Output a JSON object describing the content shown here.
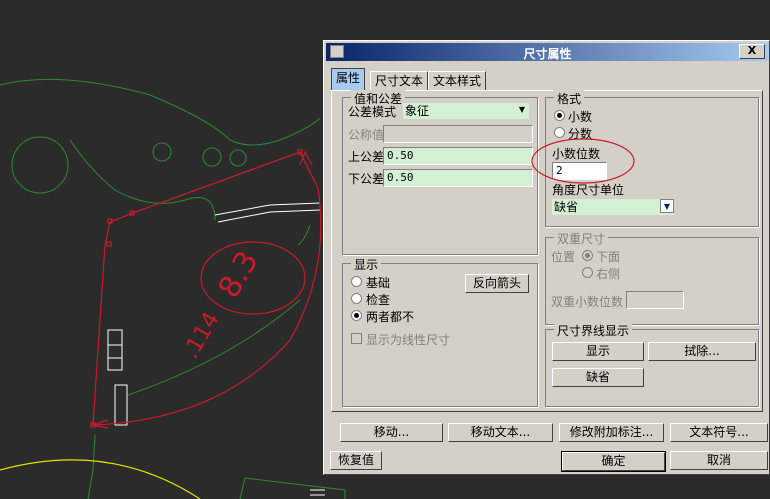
{
  "drawing": {
    "dimension_value": "8.3",
    "dimension_value_ocr": "83"
  },
  "dialog": {
    "title": "尺寸属性",
    "close_label": "X",
    "tabs": [
      {
        "label": "属性",
        "active": true
      },
      {
        "label": "尺寸文本",
        "active": false
      },
      {
        "label": "文本样式",
        "active": false
      }
    ],
    "tolerance": {
      "title": "值和公差",
      "mode_label": "公差模式",
      "mode_value": "象征",
      "nominal_label": "公称值",
      "nominal_value": "",
      "upper_label": "上公差",
      "upper_value": "0.50",
      "lower_label": "下公差",
      "lower_value": "0.50"
    },
    "format": {
      "title": "格式",
      "decimal_label": "小数",
      "fraction_label": "分数",
      "decimal_places_label": "小数位数",
      "decimal_places_value": "2",
      "angle_unit_label": "角度尺寸单位",
      "angle_unit_value": "缺省"
    },
    "display": {
      "title": "显示",
      "basic_label": "基础",
      "inspection_label": "检查",
      "neither_label": "两者都不",
      "flip_arrows_label": "反向箭头",
      "linear_label": "显示为线性尺寸"
    },
    "dual": {
      "title": "双重尺寸",
      "position_label": "位置",
      "below_label": "下面",
      "right_label": "右侧",
      "decimals_label": "双重小数位数",
      "decimals_value": ""
    },
    "witness": {
      "title": "尺寸界线显示",
      "show_label": "显示",
      "erase_label": "拭除...",
      "default_label": "缺省"
    },
    "action_buttons": {
      "move": "移动...",
      "move_text": "移动文本...",
      "modify_note": "修改附加标注...",
      "text_symbol": "文本符号..."
    },
    "footer": {
      "restore": "恢复值",
      "ok": "确定",
      "cancel": "取消"
    }
  }
}
